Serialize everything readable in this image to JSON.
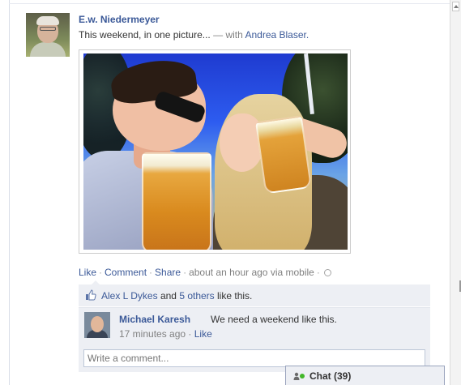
{
  "post": {
    "author": "E.w. Niedermeyer",
    "message": "This weekend, in one picture...",
    "with_prefix": "— with",
    "tagged": "Andrea Blaser."
  },
  "actions": {
    "like": "Like",
    "comment": "Comment",
    "share": "Share",
    "timestamp": "about an hour ago via mobile",
    "separator": "·"
  },
  "likes": {
    "first_name": "Alex L Dykes",
    "and": "and",
    "others": "5 others",
    "suffix": "like this."
  },
  "comment": {
    "author": "Michael Karesh",
    "text": "We need a weekend like this.",
    "time": "17 minutes ago",
    "like": "Like"
  },
  "composer": {
    "placeholder": "Write a comment..."
  },
  "chat": {
    "label": "Chat (39)",
    "status_color": "#42b72a"
  },
  "icons": {
    "like": "thumbs-up-icon",
    "mobile": "mobile-globe-icon",
    "chat": "person-online-icon"
  },
  "colors": {
    "link": "#3b5998",
    "ufi_background": "#edeff4",
    "meta_text": "#808080"
  }
}
